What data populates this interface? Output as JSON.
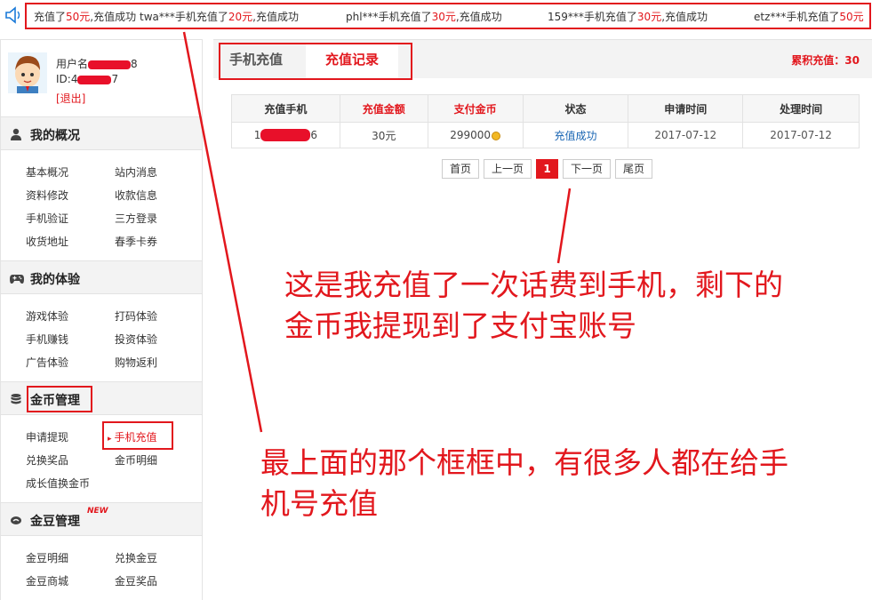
{
  "ticker": {
    "messages": [
      {
        "user": "",
        "prefix": "充值了",
        "amount": "50元",
        "suffix": ",充值成功"
      },
      {
        "user": "twa***",
        "prefix": "手机充值了",
        "amount": "20元",
        "suffix": ",充值成功"
      },
      {
        "user": "phl***",
        "prefix": "手机充值了",
        "amount": "30元",
        "suffix": ",充值成功"
      },
      {
        "user": "159***",
        "prefix": "手机充值了",
        "amount": "30元",
        "suffix": ",充值成功"
      },
      {
        "user": "etz***",
        "prefix": "手机充值了",
        "amount": "50元",
        "suffix": ""
      }
    ]
  },
  "profile": {
    "username_label": "用户名",
    "username_tail": "8",
    "id_label": "ID:4",
    "id_tail": "7",
    "logout": "[退出]"
  },
  "sidebar": {
    "sections": [
      {
        "title": "我的概况",
        "icon": "user-icon",
        "items": [
          "基本概况",
          "站内消息",
          "资料修改",
          "收款信息",
          "手机验证",
          "三方登录",
          "收货地址",
          "春季卡券"
        ]
      },
      {
        "title": "我的体验",
        "icon": "gamepad-icon",
        "items": [
          "游戏体验",
          "打码体验",
          "手机赚钱",
          "投资体验",
          "广告体验",
          "购物返利"
        ]
      },
      {
        "title": "金币管理",
        "icon": "coins-icon",
        "items": [
          "申请提现",
          "手机充值",
          "兑换奖品",
          "金币明细",
          "成长值换金币"
        ]
      },
      {
        "title": "金豆管理",
        "icon": "bean-icon",
        "badge": "NEW",
        "items": [
          "金豆明细",
          "兑换金豆",
          "金豆商城",
          "金豆奖品"
        ]
      }
    ],
    "active_item": "手机充值"
  },
  "tabs": {
    "tab1": "手机充值",
    "tab2": "充值记录"
  },
  "accumulated": "累积充值：30",
  "table": {
    "headers": [
      "充值手机",
      "充值金额",
      "支付金币",
      "状态",
      "申请时间",
      "处理时间"
    ],
    "rows": [
      {
        "phone_prefix": "1",
        "phone_suffix": "6",
        "amount": "30元",
        "coins": "299000",
        "status": "充值成功",
        "apply_time": "2017-07-12",
        "process_time": "2017-07-12"
      }
    ]
  },
  "pager": {
    "first": "首页",
    "prev": "上一页",
    "current": "1",
    "next": "下一页",
    "last": "尾页"
  },
  "annotations": {
    "note1_line1": "这是我充值了一次话费到手机，剩下的",
    "note1_line2": "金币我提现到了支付宝账号",
    "note2_line1": "最上面的那个框框中，有很多人都在给手",
    "note2_line2": "机号充值"
  },
  "colors": {
    "accent_red": "#e2171d",
    "link_blue": "#1a66b3",
    "panel_gray": "#f3f3f3"
  }
}
